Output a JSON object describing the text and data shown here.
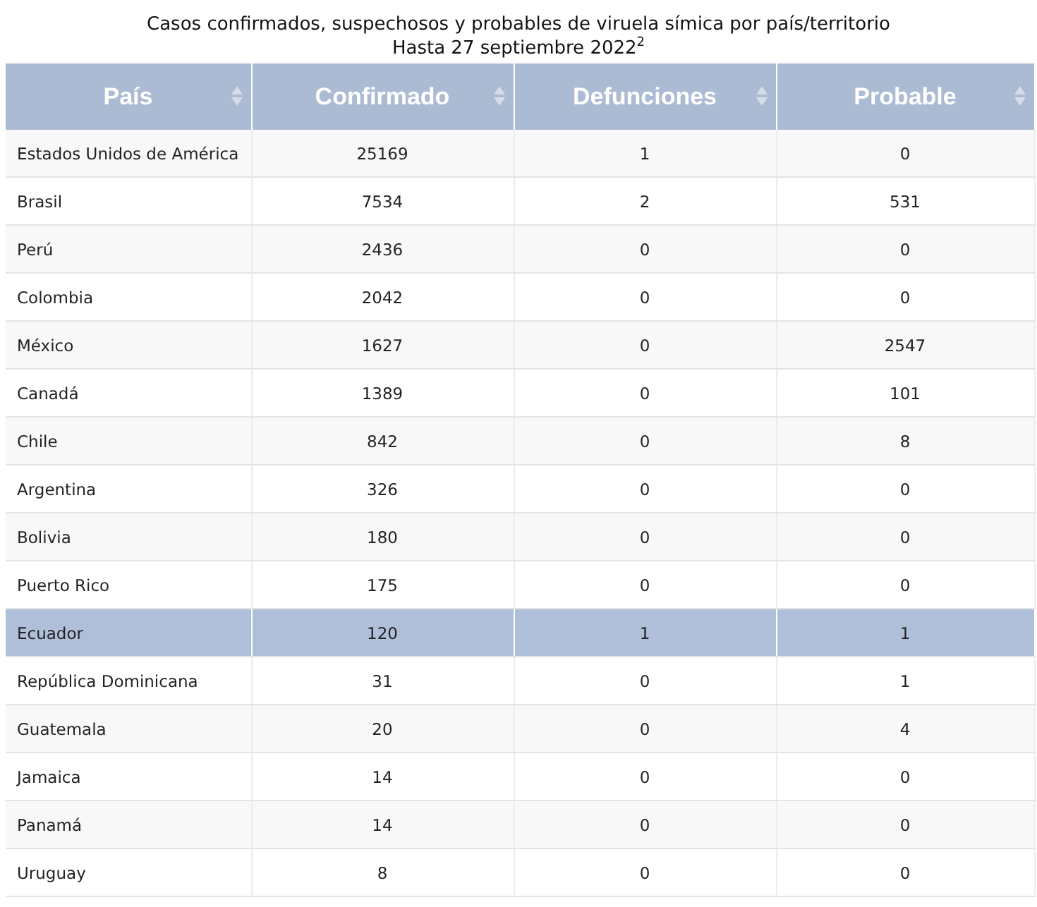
{
  "title": "Casos confirmados, suspechosos y probables de viruela símica por país/territorio",
  "subtitle": "Hasta 27 septiembre 2022$^{2}$",
  "columns": [
    "País",
    "Confirmado",
    "Defunciones",
    "Probable"
  ],
  "rows": [
    {
      "cells": [
        "Estados Unidos de América",
        "25169",
        "1",
        "0"
      ],
      "selected": false
    },
    {
      "cells": [
        "Brasil",
        "7534",
        "2",
        "531"
      ],
      "selected": false
    },
    {
      "cells": [
        "Perú",
        "2436",
        "0",
        "0"
      ],
      "selected": false
    },
    {
      "cells": [
        "Colombia",
        "2042",
        "0",
        "0"
      ],
      "selected": false
    },
    {
      "cells": [
        "México",
        "1627",
        "0",
        "2547"
      ],
      "selected": false
    },
    {
      "cells": [
        "Canadá",
        "1389",
        "0",
        "101"
      ],
      "selected": false
    },
    {
      "cells": [
        "Chile",
        "842",
        "0",
        "8"
      ],
      "selected": false
    },
    {
      "cells": [
        "Argentina",
        "326",
        "0",
        "0"
      ],
      "selected": false
    },
    {
      "cells": [
        "Bolivia",
        "180",
        "0",
        "0"
      ],
      "selected": false
    },
    {
      "cells": [
        "Puerto Rico",
        "175",
        "0",
        "0"
      ],
      "selected": false
    },
    {
      "cells": [
        "Ecuador",
        "120",
        "1",
        "1"
      ],
      "selected": true
    },
    {
      "cells": [
        "República Dominicana",
        "31",
        "0",
        "1"
      ],
      "selected": false
    },
    {
      "cells": [
        "Guatemala",
        "20",
        "0",
        "4"
      ],
      "selected": false
    },
    {
      "cells": [
        "Jamaica",
        "14",
        "0",
        "0"
      ],
      "selected": false
    },
    {
      "cells": [
        "Panamá",
        "14",
        "0",
        "0"
      ],
      "selected": false
    },
    {
      "cells": [
        "Uruguay",
        "8",
        "0",
        "0"
      ],
      "selected": false
    }
  ]
}
